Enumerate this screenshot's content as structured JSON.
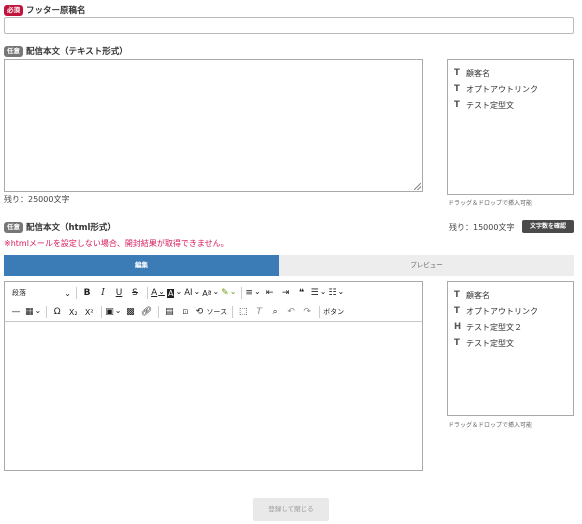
{
  "footer_name": {
    "badge": "必須",
    "label": "フッター原稿名",
    "value": ""
  },
  "text_body": {
    "badge": "任意",
    "label": "配信本文（テキスト形式）",
    "remaining": "残り：25000文字",
    "palette_items": [
      {
        "icon": "T",
        "label": "顧客名"
      },
      {
        "icon": "T",
        "label": "オプトアウトリンク"
      },
      {
        "icon": "T",
        "label": "テスト定型文"
      }
    ],
    "palette_hint": "ドラッグ＆ドロップで挿入可能"
  },
  "html_body": {
    "badge": "任意",
    "label": "配信本文（html形式）",
    "remaining": "残り：15000文字",
    "check_button": "文字数を確認",
    "warning": "※htmlメールを設定しない場合、開封結果が取得できません。",
    "tabs": [
      "編集",
      "プレビュー"
    ],
    "toolbar": {
      "paragraph": "段落",
      "source": "ソース",
      "button": "ボタン"
    },
    "palette_items": [
      {
        "icon": "T",
        "label": "顧客名"
      },
      {
        "icon": "T",
        "label": "オプトアウトリンク"
      },
      {
        "icon": "H",
        "label": "テスト定型文２"
      },
      {
        "icon": "T",
        "label": "テスト定型文"
      }
    ],
    "palette_hint": "ドラッグ＆ドロップで挿入可能"
  },
  "footer": {
    "submit_label": "登録して閉じる"
  }
}
